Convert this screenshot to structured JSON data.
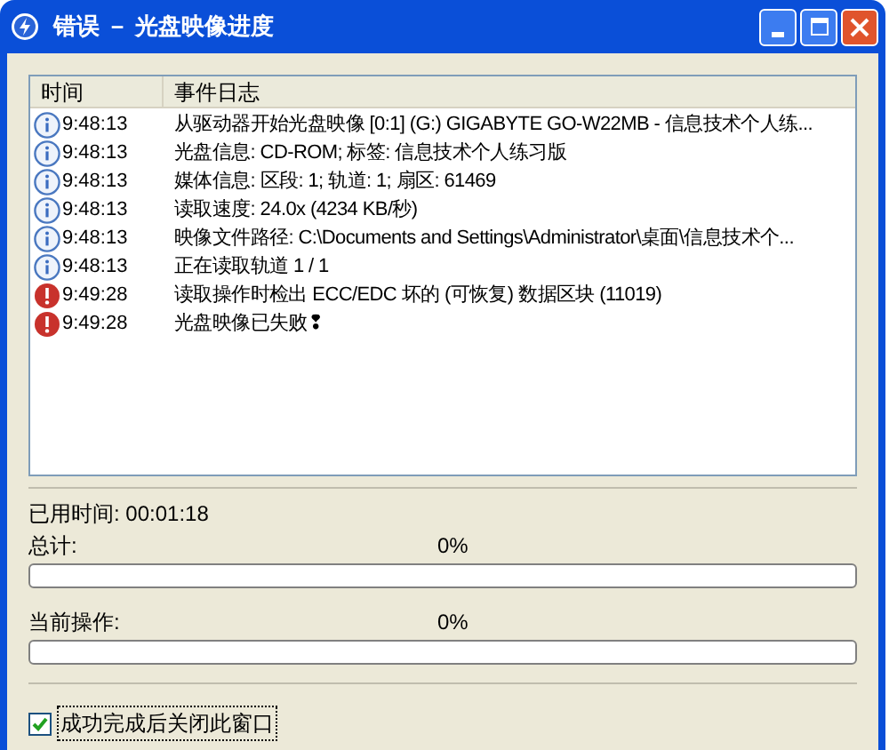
{
  "window": {
    "title": "错误 － 光盘映像进度"
  },
  "log": {
    "columns": [
      "时间",
      "事件日志"
    ],
    "rows": [
      {
        "kind": "info",
        "time": "9:48:13",
        "event": "从驱动器开始光盘映像 [0:1] (G:) GIGABYTE GO-W22MB - 信息技术个人练..."
      },
      {
        "kind": "info",
        "time": "9:48:13",
        "event": "光盘信息: CD-ROM; 标签: 信息技术个人练习版"
      },
      {
        "kind": "info",
        "time": "9:48:13",
        "event": "媒体信息: 区段: 1; 轨道: 1; 扇区: 61469"
      },
      {
        "kind": "info",
        "time": "9:48:13",
        "event": "读取速度: 24.0x (4234 KB/秒)"
      },
      {
        "kind": "info",
        "time": "9:48:13",
        "event": "映像文件路径: C:\\Documents and Settings\\Administrator\\桌面\\信息技术个..."
      },
      {
        "kind": "info",
        "time": "9:48:13",
        "event": "正在读取轨道 1 / 1"
      },
      {
        "kind": "error",
        "time": "9:49:28",
        "event": "读取操作时检出 ECC/EDC 坏的 (可恢复) 数据区块 (11019)"
      },
      {
        "kind": "error",
        "time": "9:49:28",
        "event": "光盘映像已失败❢"
      }
    ]
  },
  "elapsed": "已用时间: 00:01:18",
  "progress": [
    {
      "label": "总计:",
      "percent": "0%",
      "level": 0
    },
    {
      "label": "当前操作:",
      "percent": "0%",
      "level": 0
    }
  ],
  "close_when_done": {
    "label": "成功完成后关闭此窗口",
    "checked": true
  }
}
